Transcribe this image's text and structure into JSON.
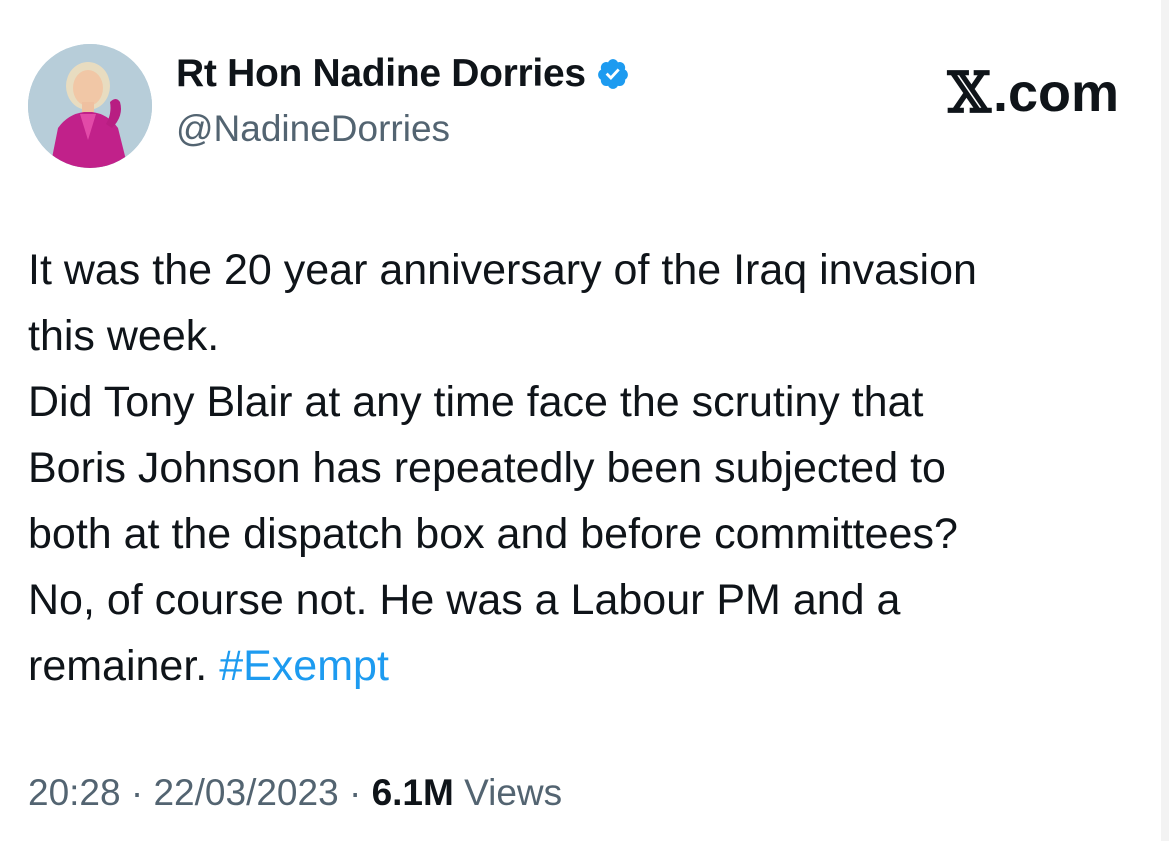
{
  "author": {
    "display_name": "Rt Hon Nadine Dorries",
    "handle": "@NadineDorries",
    "verified": true,
    "avatar_icon": "profile-photo"
  },
  "brand": {
    "x_glyph": "𝕏",
    "domain": ".com"
  },
  "tweet": {
    "lines": [
      "It was the 20 year anniversary of the Iraq invasion",
      "this week.",
      "Did Tony Blair at any time face the scrutiny that",
      "Boris Johnson has repeatedly been subjected to",
      "both at the dispatch box and before committees?",
      "No, of course not. He was a Labour PM and a",
      "remainer. "
    ],
    "hashtag": "#Exempt"
  },
  "meta": {
    "time": "20:28",
    "separator": "·",
    "date": "22/03/2023",
    "views_count": "6.1M",
    "views_label": "Views"
  },
  "colors": {
    "text": "#0f1419",
    "secondary": "#536471",
    "link": "#1d9bf0",
    "verified_badge": "#1d9bf0"
  }
}
